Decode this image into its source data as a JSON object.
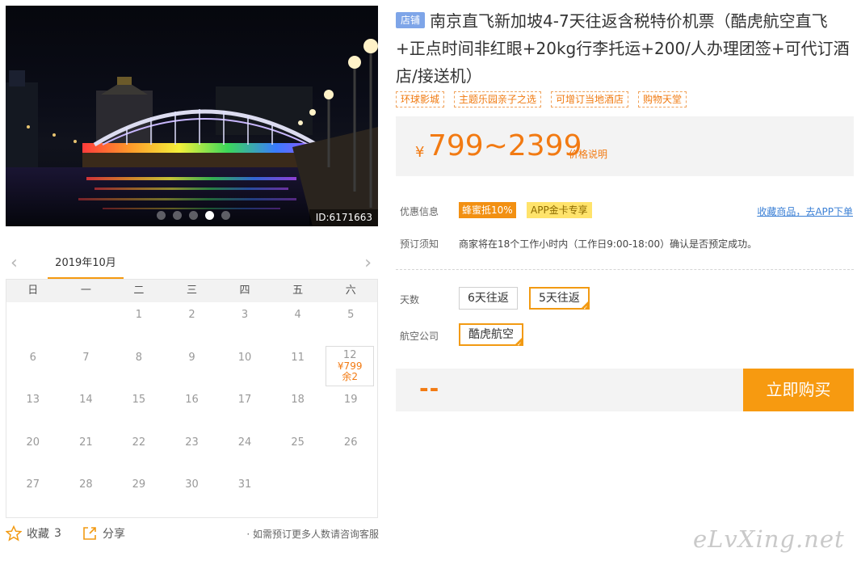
{
  "photo": {
    "id_label": "ID:6171663",
    "dots": 5,
    "active_dot": 3
  },
  "calendar": {
    "prev_icon": "chevron-left-icon",
    "next_icon": "chevron-right-icon",
    "month": "2019年10月",
    "weekdays": [
      "日",
      "一",
      "二",
      "三",
      "四",
      "五",
      "六"
    ],
    "days": [
      {
        "d": ""
      },
      {
        "d": ""
      },
      {
        "d": "1"
      },
      {
        "d": "2"
      },
      {
        "d": "3"
      },
      {
        "d": "4"
      },
      {
        "d": "5"
      },
      {
        "d": "6"
      },
      {
        "d": "7"
      },
      {
        "d": "8"
      },
      {
        "d": "9"
      },
      {
        "d": "10"
      },
      {
        "d": "11"
      },
      {
        "d": "12",
        "price": "¥799",
        "stock": "余2"
      },
      {
        "d": "13"
      },
      {
        "d": "14"
      },
      {
        "d": "15"
      },
      {
        "d": "16"
      },
      {
        "d": "17"
      },
      {
        "d": "18"
      },
      {
        "d": "19"
      },
      {
        "d": "20"
      },
      {
        "d": "21"
      },
      {
        "d": "22"
      },
      {
        "d": "23"
      },
      {
        "d": "24"
      },
      {
        "d": "25"
      },
      {
        "d": "26"
      },
      {
        "d": "27"
      },
      {
        "d": "28"
      },
      {
        "d": "29"
      },
      {
        "d": "30"
      },
      {
        "d": "31"
      },
      {
        "d": ""
      },
      {
        "d": ""
      }
    ]
  },
  "footer": {
    "favorite_label": "收藏",
    "favorite_count": "3",
    "share_label": "分享",
    "note": "· 如需预订更多人数请咨询客服"
  },
  "product": {
    "shop_tag": "店铺",
    "title": "南京直飞新加坡4-7天往返含税特价机票（酷虎航空直飞+正点时间非红眼+20kg行李托运+200/人办理团签+可代订酒店/接送机）",
    "tags": [
      "环球影城",
      "主题乐园亲子之选",
      "可增订当地酒店",
      "购物天堂"
    ],
    "price_symbol": "¥",
    "price_range": "799~2399",
    "price_explain": "价格说明"
  },
  "info": {
    "discount_label": "优惠信息",
    "discount_badge": "蜂蜜抵10%",
    "app_badge": "APP金卡专享",
    "app_link": "收藏商品，去APP下单",
    "notice_label": "预订须知",
    "notice_text": "商家将在18个工作小时内（工作日9:00-18:00）确认是否预定成功。"
  },
  "options": {
    "days_label": "天数",
    "days": [
      "6天往返",
      "5天往返"
    ],
    "days_selected": 1,
    "airline_label": "航空公司",
    "airlines": [
      "酷虎航空"
    ],
    "airline_selected": 0
  },
  "buy": {
    "total": "--",
    "button": "立即购买"
  },
  "watermark": "eLvXing.net",
  "colors": {
    "accent": "#f29a12",
    "price": "#f27a12",
    "link": "#3a7fd5",
    "shop_tag": "#7ea5e8"
  }
}
